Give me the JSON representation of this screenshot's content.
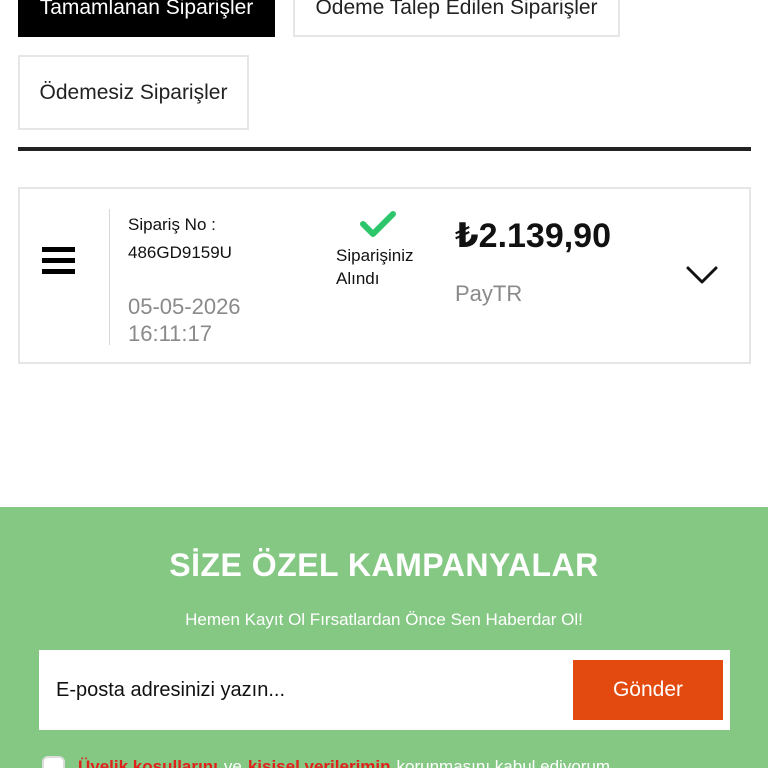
{
  "tabs": {
    "completed": "Tamamlanan Siparişler",
    "payment_requested": "Ödeme Talep Edilen Siparişler",
    "unpaid": "Ödemesiz Siparişler"
  },
  "order": {
    "number_label": "Sipariş No :",
    "number": "486GD9159U",
    "date": "05-05-2026",
    "time": "16:11:17",
    "status_line1": "Siparişiniz",
    "status_line2": "Alındı",
    "price": "₺2.139,90",
    "payment_method": "PayTR"
  },
  "campaign": {
    "title": "SİZE ÖZEL KAMPANYALAR",
    "subtitle": "Hemen Kayıt Ol Fırsatlardan Önce Sen Haberdar Ol!",
    "email_placeholder": "E-posta adresinizi yazın...",
    "send_label": "Gönder",
    "consent_link1": "Üyelik koşullarını",
    "consent_and": "ve",
    "consent_link2": "kişisel verilerimin",
    "consent_rest": "korunmasını kabul ediyorum."
  },
  "colors": {
    "campaign_bg": "#85c884",
    "send_button": "#e34a10",
    "check": "#2ec66b",
    "consent_link": "#e0201b"
  },
  "icons": {
    "menu": "hamburger-icon",
    "status": "check-icon",
    "expand": "chevron-down-icon"
  }
}
